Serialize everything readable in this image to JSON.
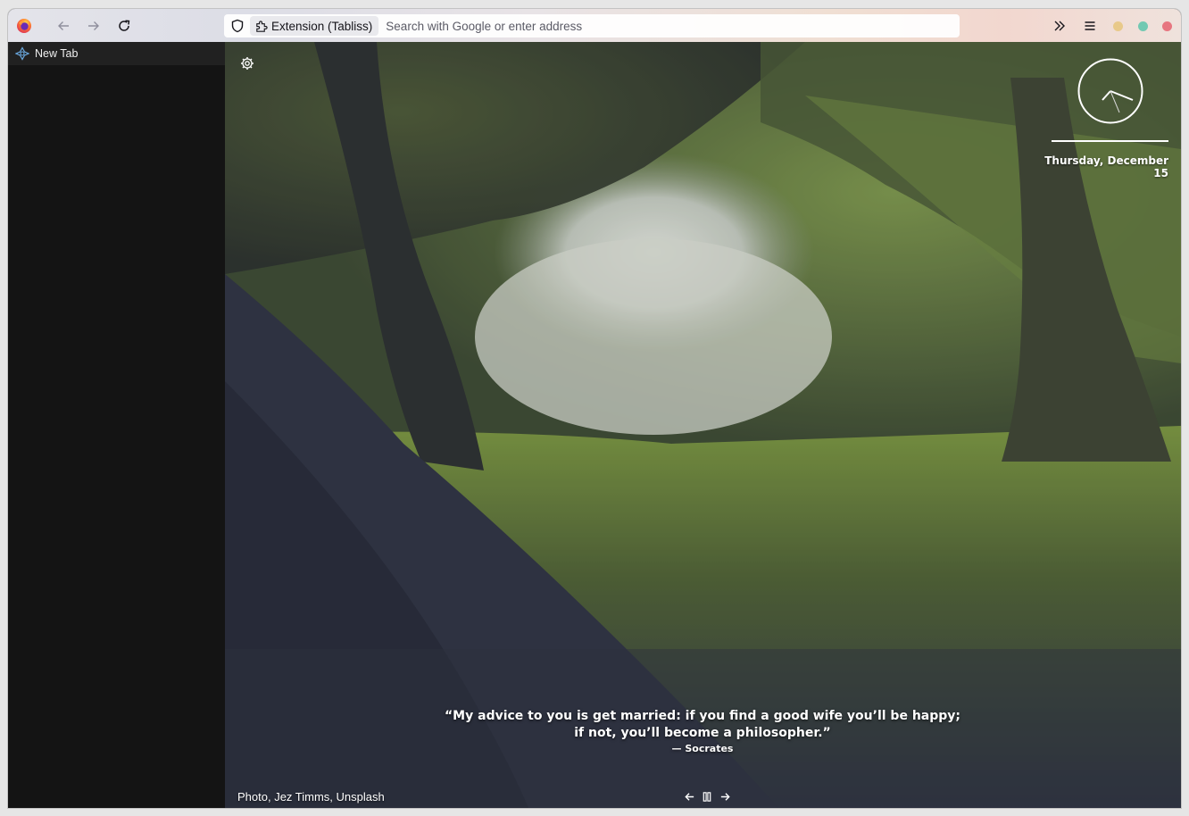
{
  "browser": {
    "url_chip_label": "Extension (Tabliss)",
    "url_placeholder": "Search with Google or enter address"
  },
  "sidebar": {
    "tabs": [
      {
        "label": "New Tab",
        "icon": "tabliss-icon"
      }
    ]
  },
  "dashboard": {
    "date": "Thursday, December 15",
    "quote": {
      "line1": "“My advice to you is get married: if you find a good wife you’ll be happy;",
      "line2": "if not, you’ll become a philosopher.”",
      "author": "— Socrates"
    },
    "credit": "Photo, Jez Timms, Unsplash"
  },
  "icons": {
    "settings": "gear-icon",
    "previous": "arrow-left-icon",
    "pause": "pause-icon",
    "next": "arrow-right-icon"
  },
  "colors": {
    "window_min": "#e8c98a",
    "window_max": "#72c9b2",
    "window_close": "#e77680"
  }
}
